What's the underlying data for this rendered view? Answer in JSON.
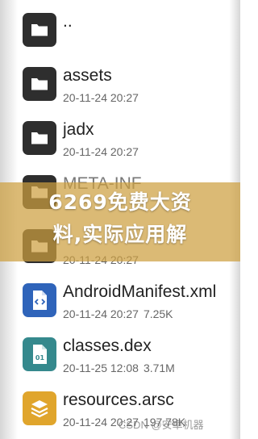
{
  "files": [
    {
      "name": "..",
      "type": "folder",
      "date": "",
      "size": ""
    },
    {
      "name": "assets",
      "type": "folder",
      "date": "20-11-24 20:27",
      "size": ""
    },
    {
      "name": "jadx",
      "type": "folder",
      "date": "20-11-24 20:27",
      "size": ""
    },
    {
      "name": "META-INF",
      "type": "folder",
      "date": "20-11-24 20:27",
      "size": ""
    },
    {
      "name": "",
      "type": "folder",
      "date": "20-11-24 20:27",
      "size": ""
    },
    {
      "name": "AndroidManifest.xml",
      "type": "xml-file",
      "date": "20-11-24 20:27",
      "size": "7.25K"
    },
    {
      "name": "classes.dex",
      "type": "dex-file",
      "date": "20-11-25 12:08",
      "size": "3.71M"
    },
    {
      "name": "resources.arsc",
      "type": "arsc-file",
      "date": "20-11-24 20:27",
      "size": "197.78K"
    }
  ],
  "banner": {
    "line1": "6269免费大资",
    "line2": "料,实际应用解"
  },
  "watermark": "CSDN @安卓机器",
  "icons": {
    "folder": "folder-icon",
    "xml-file": "code-file-icon",
    "dex-file": "binary-file-icon",
    "arsc-file": "layers-file-icon"
  },
  "colors": {
    "folder_icon": "#2e2e2e",
    "xml_icon": "#2f64ba",
    "dex_icon": "#35898d",
    "arsc_icon": "#e0a52c",
    "banner": "#cda040"
  }
}
